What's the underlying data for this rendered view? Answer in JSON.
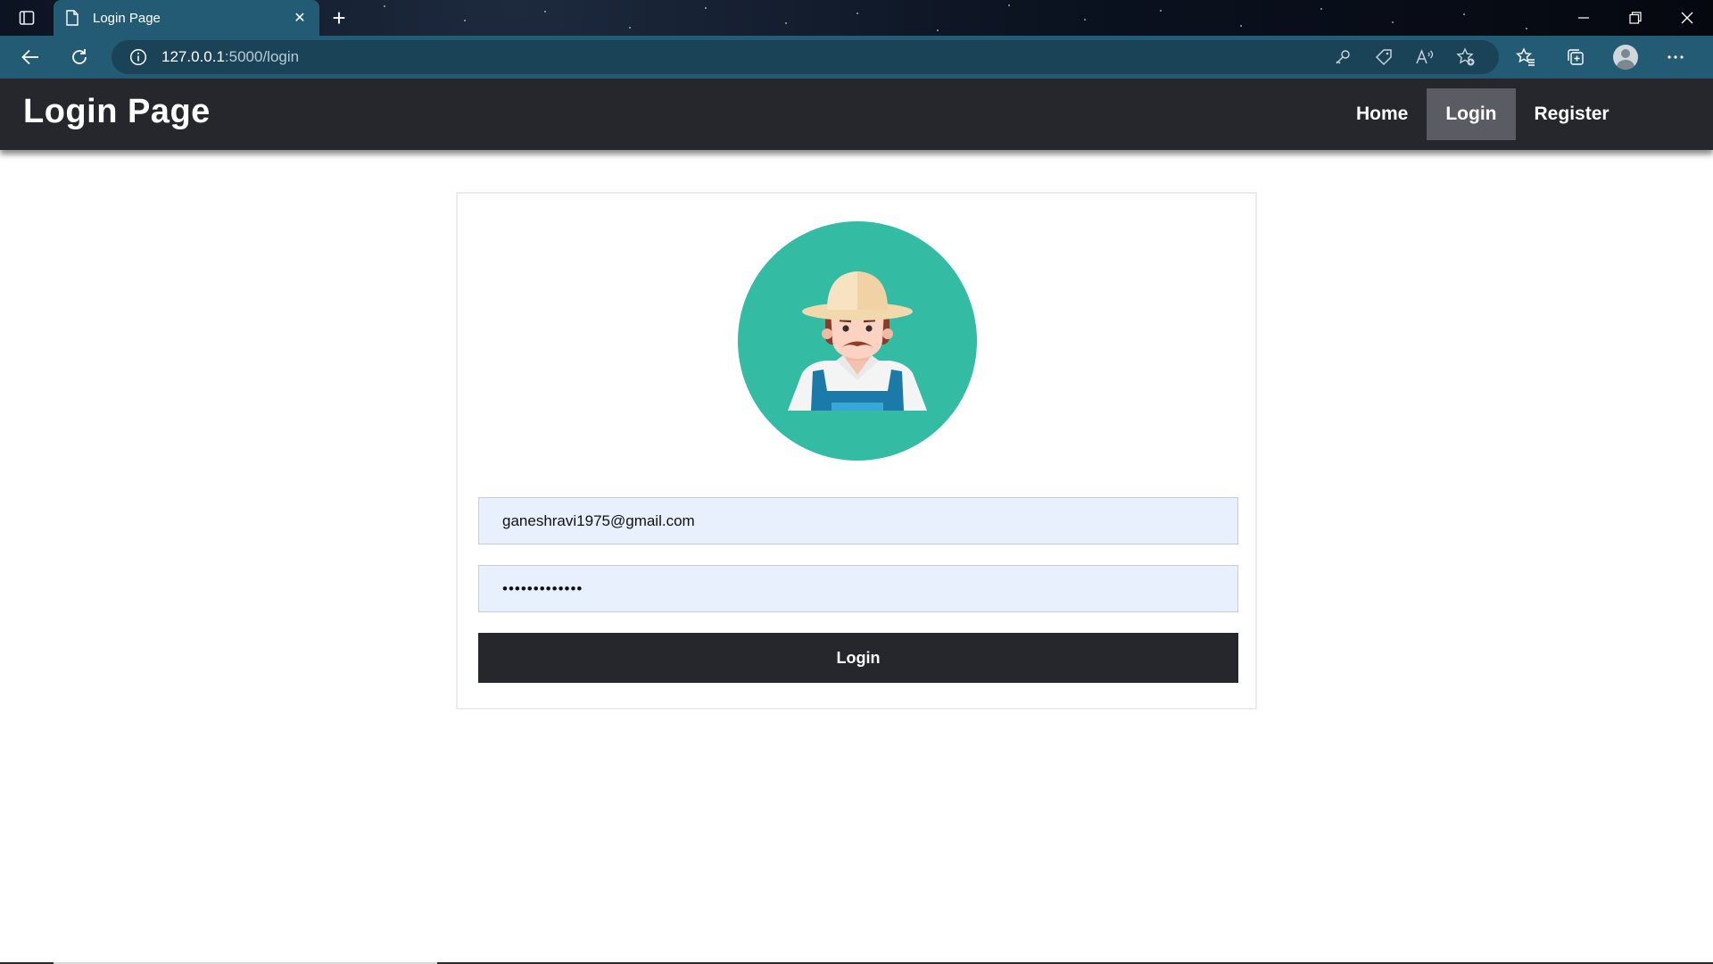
{
  "browser": {
    "tab": {
      "title": "Login Page",
      "icon": "document-icon"
    },
    "address": {
      "host": "127.0.0.1",
      "rest": ":5000/login"
    }
  },
  "site": {
    "title": "Login Page",
    "nav": [
      {
        "label": "Home",
        "active": false
      },
      {
        "label": "Login",
        "active": true
      },
      {
        "label": "Register",
        "active": false
      }
    ]
  },
  "form": {
    "email_value": "ganeshravi1975@gmail.com",
    "password_value": "•••••••••••••",
    "submit_label": "Login"
  },
  "colors": {
    "nav_bg": "#26272c",
    "nav_active": "#5a5c64",
    "browser_accent": "#235a74",
    "avatar_bg": "#34bba4",
    "input_bg": "#e8f0fe"
  }
}
